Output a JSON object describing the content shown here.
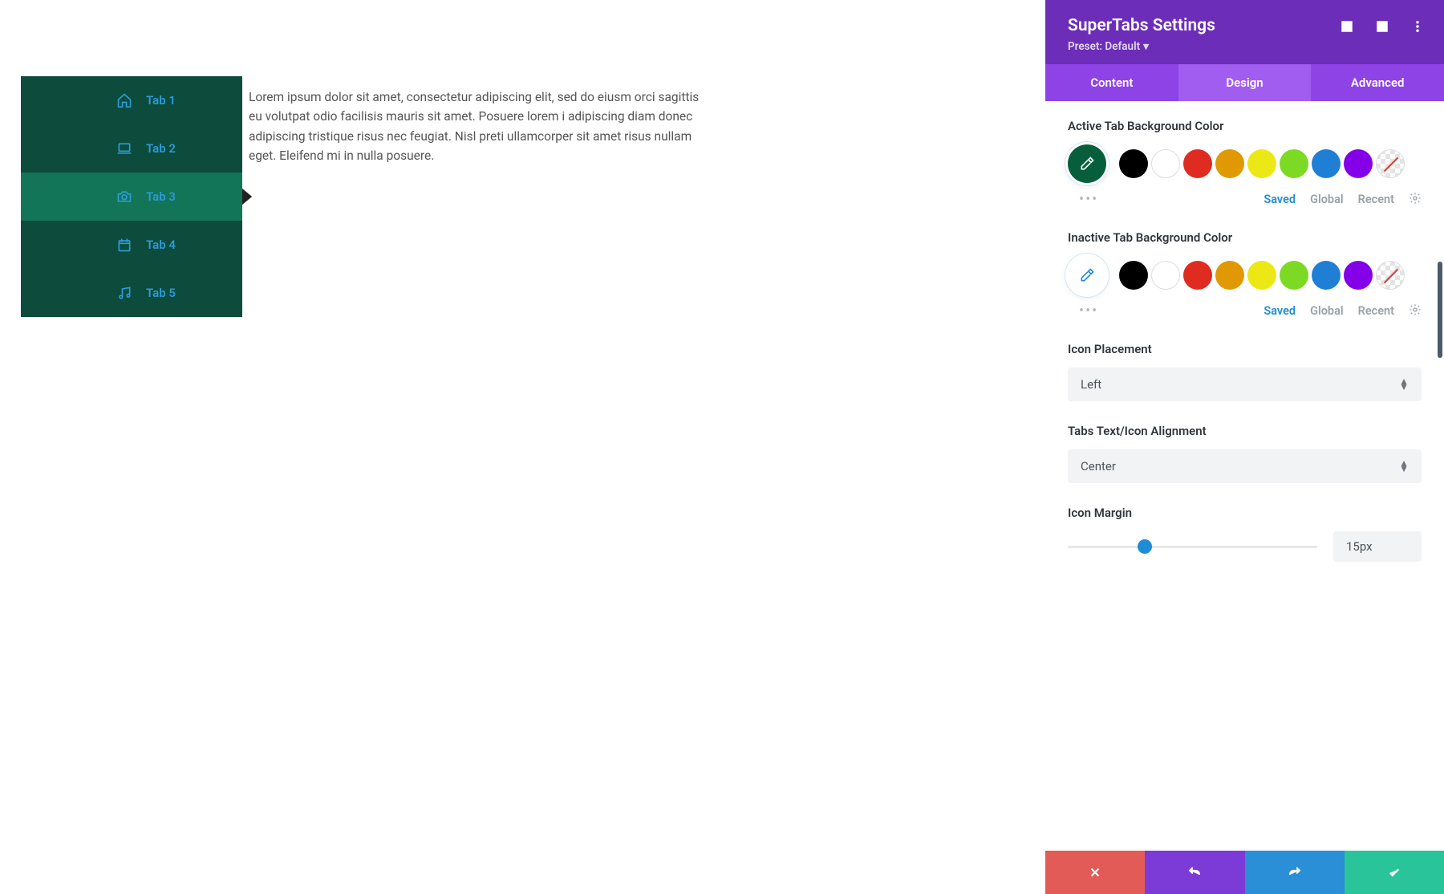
{
  "preview": {
    "tabs": [
      {
        "label": "Tab 1"
      },
      {
        "label": "Tab 2"
      },
      {
        "label": "Tab 3"
      },
      {
        "label": "Tab 4"
      },
      {
        "label": "Tab 5"
      }
    ],
    "active_index": 2,
    "body_text": "Lorem ipsum dolor sit amet, consectetur adipiscing elit, sed do eiusm orci sagittis eu volutpat odio facilisis mauris sit amet. Posuere lorem i adipiscing diam donec adipiscing tristique risus nec feugiat. Nisl preti ullamcorper sit amet risus nullam eget. Eleifend mi in nulla posuere."
  },
  "panel": {
    "title": "SuperTabs Settings",
    "preset_label": "Preset: Default",
    "tabs": {
      "content": "Content",
      "design": "Design",
      "advanced": "Advanced"
    },
    "active_tab": "design",
    "palette_meta": {
      "saved": "Saved",
      "global": "Global",
      "recent": "Recent"
    },
    "palette_colors": [
      "#000000",
      "#ffffff",
      "#e02b20",
      "#e09900",
      "#ece815",
      "#7cda24",
      "#1f7fd4",
      "#8300e9"
    ],
    "groups": {
      "active_bg": {
        "label": "Active Tab Background Color",
        "picker_bg": "#075e3c",
        "picker_icon_white": true
      },
      "inactive_bg": {
        "label": "Inactive Tab Background Color",
        "picker_bg": "#ffffff",
        "picker_icon_white": false
      },
      "icon_placement": {
        "label": "Icon Placement",
        "value": "Left"
      },
      "text_align": {
        "label": "Tabs Text/Icon Alignment",
        "value": "Center"
      },
      "icon_margin": {
        "label": "Icon Margin",
        "value": "15px",
        "percent": 28
      }
    }
  },
  "footer": {
    "cancel": "cancel",
    "undo": "undo",
    "redo": "redo",
    "confirm": "confirm"
  }
}
